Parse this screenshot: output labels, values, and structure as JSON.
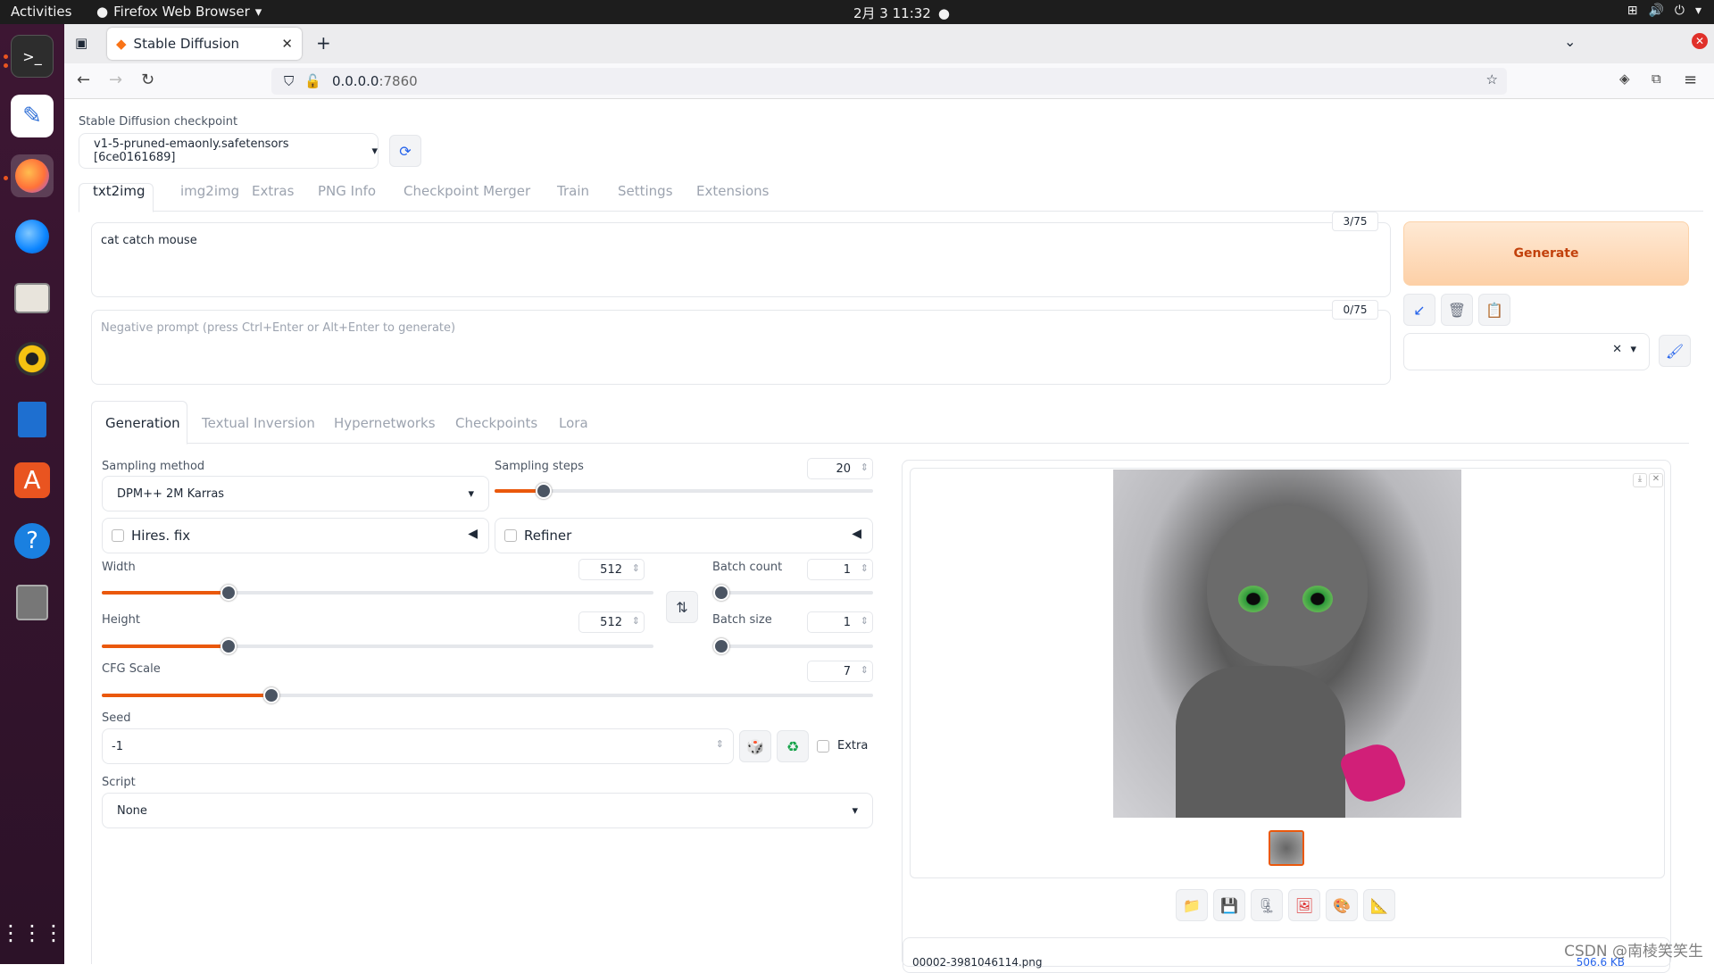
{
  "os": {
    "activities": "Activities",
    "app_name": "Firefox Web Browser",
    "clock": "2月 3  11:32"
  },
  "browser": {
    "tab_title": "Stable Diffusion",
    "url_host": "0.0.0.0",
    "url_port": ":7860"
  },
  "checkpoint": {
    "label": "Stable Diffusion checkpoint",
    "value": "v1-5-pruned-emaonly.safetensors [6ce0161689]"
  },
  "main_tabs": [
    "txt2img",
    "img2img",
    "Extras",
    "PNG Info",
    "Checkpoint Merger",
    "Train",
    "Settings",
    "Extensions"
  ],
  "prompt": {
    "text": "cat catch mouse",
    "counter": "3/75",
    "neg_placeholder": "Negative prompt (press Ctrl+Enter or Alt+Enter to generate)",
    "neg_counter": "0/75"
  },
  "generate_label": "Generate",
  "sub_tabs": [
    "Generation",
    "Textual Inversion",
    "Hypernetworks",
    "Checkpoints",
    "Lora"
  ],
  "params": {
    "sampling_method_label": "Sampling method",
    "sampling_method": "DPM++ 2M Karras",
    "sampling_steps_label": "Sampling steps",
    "sampling_steps": "20",
    "sampling_steps_frac": 0.13,
    "hires_label": "Hires. fix",
    "refiner_label": "Refiner",
    "width_label": "Width",
    "width": "512",
    "width_frac": 0.23,
    "height_label": "Height",
    "height": "512",
    "height_frac": 0.23,
    "batch_count_label": "Batch count",
    "batch_count": "1",
    "batch_count_frac": 0.0,
    "batch_size_label": "Batch size",
    "batch_size": "1",
    "batch_size_frac": 0.0,
    "cfg_label": "CFG Scale",
    "cfg": "7",
    "cfg_frac": 0.22,
    "seed_label": "Seed",
    "seed": "-1",
    "extra_label": "Extra",
    "script_label": "Script",
    "script": "None"
  },
  "output": {
    "filename": "00002-3981046114.png",
    "size": "506.6 KB"
  },
  "watermark": "CSDN @南棱笑笑生",
  "colors": {
    "accent": "#ea580c",
    "generate_bg": "#fdd9b5",
    "generate_text": "#c2410c"
  }
}
